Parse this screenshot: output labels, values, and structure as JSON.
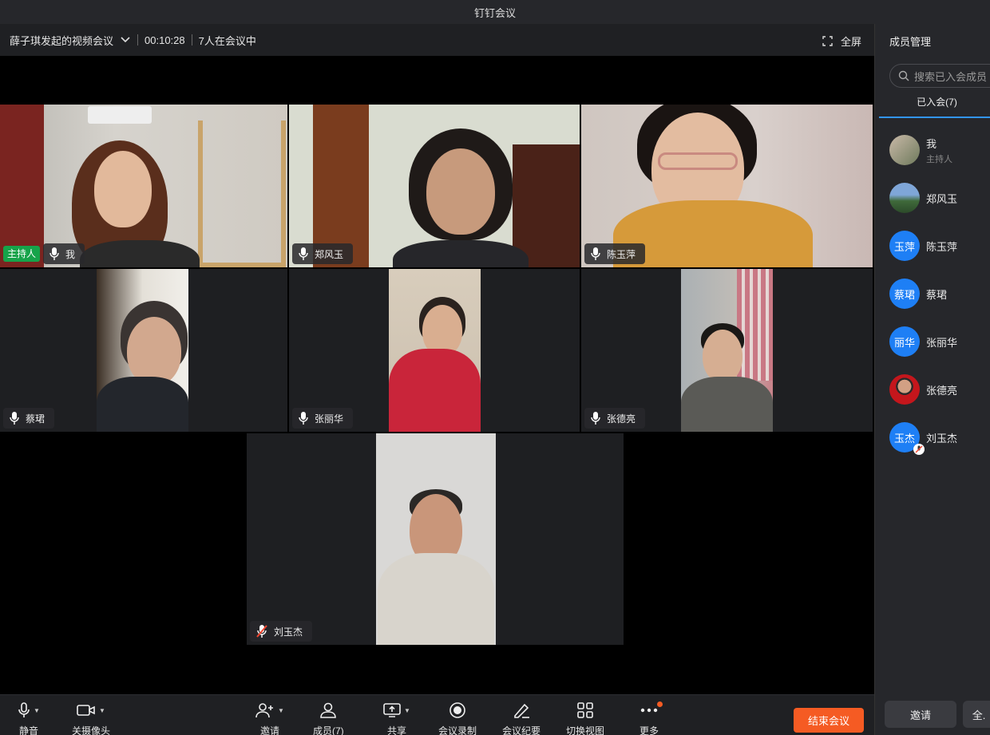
{
  "window": {
    "title": "钉钉会议"
  },
  "meeting": {
    "title": "薛子琪发起的视频会议",
    "elapsed": "00:10:28",
    "count_text": "7人在会议中",
    "fullscreen_label": "全屏"
  },
  "tiles": [
    {
      "name": "我",
      "host_tag": "主持人",
      "mic": "on"
    },
    {
      "name": "郑风玉",
      "mic": "on"
    },
    {
      "name": "陈玉萍",
      "mic": "on"
    },
    {
      "name": "蔡珺",
      "mic": "on"
    },
    {
      "name": "张丽华",
      "mic": "on"
    },
    {
      "name": "张德亮",
      "mic": "on"
    },
    {
      "name": "刘玉杰",
      "mic": "muted"
    }
  ],
  "sidebar": {
    "title": "成员管理",
    "search_placeholder": "搜索已入会成员",
    "tab_label": "已入会(7)",
    "members": [
      {
        "name": "我",
        "role": "主持人",
        "avatar_text": ""
      },
      {
        "name": "郑风玉",
        "avatar_text": ""
      },
      {
        "name": "陈玉萍",
        "avatar_text": "玉萍"
      },
      {
        "name": "蔡珺",
        "avatar_text": "蔡珺"
      },
      {
        "name": "张丽华",
        "avatar_text": "丽华"
      },
      {
        "name": "张德亮",
        "avatar_text": ""
      },
      {
        "name": "刘玉杰",
        "avatar_text": "玉杰",
        "muted": true
      }
    ],
    "invite_label": "邀请",
    "all_label": "全."
  },
  "toolbar": {
    "mute": "静音",
    "camera_off": "关摄像头",
    "invite": "邀请",
    "members": "成员(7)",
    "share": "共享",
    "record": "会议录制",
    "minutes": "会议纪要",
    "switch_view": "切换视图",
    "more": "更多",
    "end": "结束会议"
  },
  "colors": {
    "accent": "#3296fa",
    "end": "#f55b23",
    "host": "#16a34a"
  }
}
